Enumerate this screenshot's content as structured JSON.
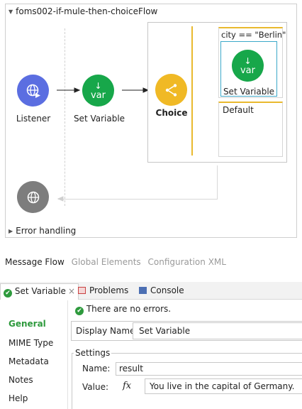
{
  "flow": {
    "title": "foms002-if-mule-then-choiceFlow",
    "nodes": {
      "listener": "Listener",
      "set_variable": "Set Variable",
      "choice": "Choice",
      "var_text": "var"
    },
    "choice": {
      "route_condition": "city == \"Berlin\"",
      "route_node_label": "Set Variable",
      "default_label": "Default"
    },
    "error_handling": "Error handling"
  },
  "editor_tabs": [
    "Message Flow",
    "Global Elements",
    "Configuration XML"
  ],
  "panel": {
    "tabs": {
      "set_variable": "Set Variable",
      "problems": "Problems",
      "console": "Console",
      "close": "×"
    },
    "side_nav": [
      "General",
      "MIME Type",
      "Metadata",
      "Notes",
      "Help"
    ],
    "status_message": "There are no errors.",
    "display_name_label": "Display Name:",
    "display_name_value": "Set Variable",
    "settings_legend": "Settings",
    "name_label": "Name:",
    "name_value": "result",
    "value_label": "Value:",
    "fx_label": "fx",
    "value_value": "You live in the capital of Germany."
  },
  "colors": {
    "listener": "#5b6ee1",
    "set_variable": "#17a74a",
    "choice": "#f0b925",
    "error_node": "#7d7d7d",
    "accent_green": "#2e9a3d",
    "selection": "#3ba8c9"
  }
}
